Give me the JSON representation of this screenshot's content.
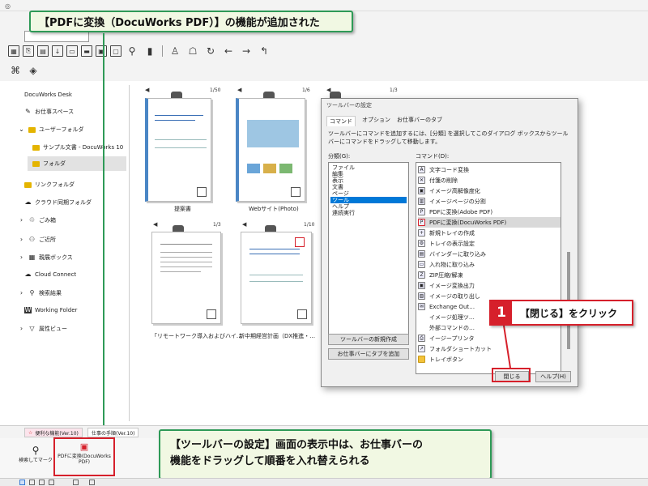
{
  "window": {
    "title": "DocuWorks Desk"
  },
  "toolbar": {
    "icons": [
      "grid-icon",
      "copy-icon",
      "print-icon",
      "import-icon",
      "export-icon",
      "folder-icon",
      "send-icon",
      "monitor-icon",
      "zoom-icon",
      "bookmark-icon",
      "stamp-icon",
      "annotation-icon",
      "rotate-icon",
      "back-arrow-icon",
      "forward-arrow-icon",
      "up-arrow-icon"
    ]
  },
  "sidebar": {
    "items": [
      {
        "label": "DocuWorks Desk"
      },
      {
        "label": "お仕事スペース"
      },
      {
        "label": "ユーザーフォルダ"
      },
      {
        "label": "サンプル文書 - DocuWorks 10"
      },
      {
        "label": "フォルダ"
      },
      {
        "label": "リンクフォルダ"
      },
      {
        "label": "クラウド同期フォルダ"
      },
      {
        "label": "ごみ箱"
      },
      {
        "label": "ご近所"
      },
      {
        "label": "親展ボックス"
      },
      {
        "label": "Cloud Connect"
      },
      {
        "label": "検索結果"
      },
      {
        "label": "Working Folder"
      },
      {
        "label": "属性ビュー"
      }
    ]
  },
  "documents": [
    {
      "name": "提案書",
      "page": "1/50"
    },
    {
      "name": "Webサイト(Photo)",
      "page": "1/6"
    },
    {
      "name": "",
      "page": "1/3"
    },
    {
      "name": "「リモートワーク導入およびハイ…",
      "page": "1/3"
    },
    {
      "name": "新中期経営計画（DX推進・…",
      "page": "1/10"
    }
  ],
  "dialog": {
    "title": "ツールバーの設定",
    "tabs": [
      "コマンド",
      "オプション",
      "お仕事バーのタブ"
    ],
    "description": "ツールバーにコマンドを追加するには、[分類] を選択してこのダイアログ ボックスからツール バーにコマンドをドラッグして移動します。",
    "category_label": "分類(G):",
    "command_label": "コマンド(D):",
    "categories": [
      "ファイル",
      "編集",
      "表示",
      "文書",
      "ページ",
      "ツール",
      "ヘルプ",
      "連続実行"
    ],
    "selected_category": "ツール",
    "commands": [
      "文字コード変換",
      "付箋の削除",
      "イメージ高解像度化",
      "イメージページの分割",
      "PDFに変換(Adobe PDF)",
      "PDFに変換(DocuWorks PDF)",
      "新規トレイの作成",
      "トレイの表示設定",
      "バインダーに取り込み",
      "入れ物に取り込み",
      "ZIP圧縮/解凍",
      "イメージ変換出力",
      "イメージの取り出し",
      "Exchange Out…",
      "イメージ処理ツ…",
      "外部コマンドの…",
      "イージープリンタ",
      "フォルダショートカット",
      "トレイボタン"
    ],
    "selected_command": "PDFに変換(DocuWorks PDF)",
    "new_toolbar_button": "ツールバーの新規作成",
    "add_tab_button": "お仕事バーにタブを追加",
    "close_button": "閉じる",
    "help_button": "ヘルプ(H)"
  },
  "tabs": [
    {
      "label": "便利な機能(Ver.10)"
    },
    {
      "label": "仕事の手順(Ver.10)"
    }
  ],
  "work_bar": {
    "buttons": [
      {
        "label": "検索してマーク"
      },
      {
        "label": "PDFに変換(DocuWorks PDF)"
      }
    ]
  },
  "annotations": {
    "top": "【PDFに変換（DocuWorks PDF）】の機能が追加された",
    "bottom_line1": "【ツールバーの設定】画面の表示中は、お仕事バーの",
    "bottom_line2": "機能をドラッグして順番を入れ替えられる",
    "step_number": "1",
    "step_text": "【閉じる】をクリック"
  },
  "colors": {
    "callout_border": "#2e9a57",
    "callout_fill": "#f1f8e3",
    "highlight_red": "#d6202b",
    "selection_blue": "#0078d7",
    "folder_yellow": "#e4b400",
    "doc_blue": "#4a86c5"
  }
}
